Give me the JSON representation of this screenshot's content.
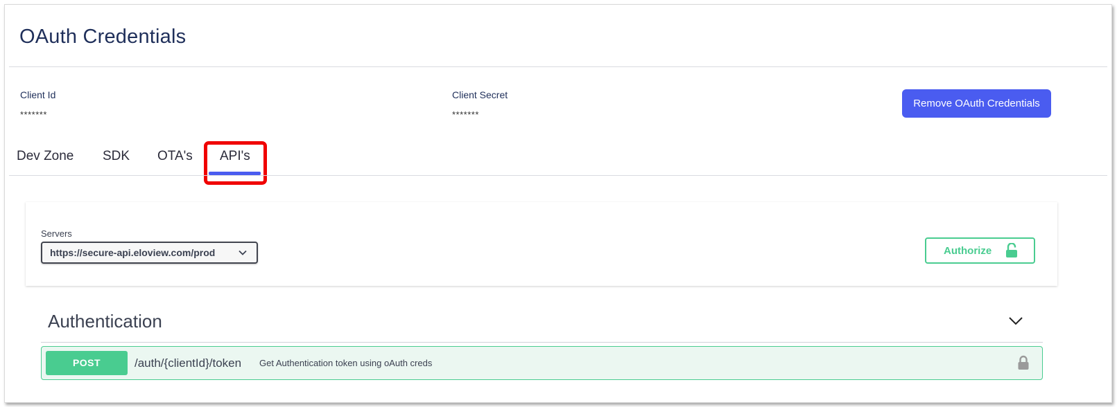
{
  "page": {
    "title": "OAuth Credentials"
  },
  "credentials": {
    "client_id": {
      "label": "Client Id",
      "value": "*******"
    },
    "client_secret": {
      "label": "Client Secret",
      "value": "*******"
    },
    "remove_button": "Remove OAuth Credentials"
  },
  "tabs": [
    {
      "label": "Dev Zone",
      "active": false
    },
    {
      "label": "SDK",
      "active": false
    },
    {
      "label": "OTA's",
      "active": false
    },
    {
      "label": "API's",
      "active": true
    }
  ],
  "servers": {
    "label": "Servers",
    "selected": "https://secure-api.eloview.com/prod",
    "icon": "chevron-down-icon"
  },
  "authorize": {
    "label": "Authorize",
    "icon": "lock-open-icon"
  },
  "section": {
    "title": "Authentication",
    "icon": "chevron-down-icon"
  },
  "operations": [
    {
      "method": "POST",
      "path": "/auth/{clientId}/token",
      "summary": "Get Authentication token using oAuth creds",
      "icon": "lock-icon"
    }
  ],
  "colors": {
    "title": "#1f2f5a",
    "accent": "#4a5cf0",
    "post": "#49cc90",
    "post_bg": "#ebf7f1",
    "highlight": "#f00000"
  }
}
